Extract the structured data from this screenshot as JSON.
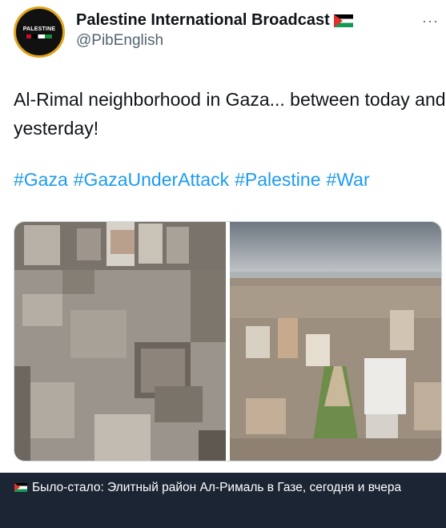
{
  "tweet": {
    "display_name": "Palestine International Broadcast",
    "handle": "@PibEnglish",
    "avatar_text": "PALESTINE",
    "more_icon": "ellipsis-icon",
    "text": "Al-Rimal neighborhood in Gaza... between today and yesterday!",
    "hashtags": [
      "#Gaza",
      "#GazaUnderAttack",
      "#Palestine",
      "#War"
    ],
    "link_color": "#1d9bf0"
  },
  "media": {
    "left_image": "destroyed-neighborhood-aerial-photo",
    "right_image": "city-neighborhood-aerial-photo"
  },
  "caption": {
    "text": "Было-стало: Элитный район Ал-Рималь в Газе, сегодня и вчера",
    "background": "#1c2534"
  }
}
